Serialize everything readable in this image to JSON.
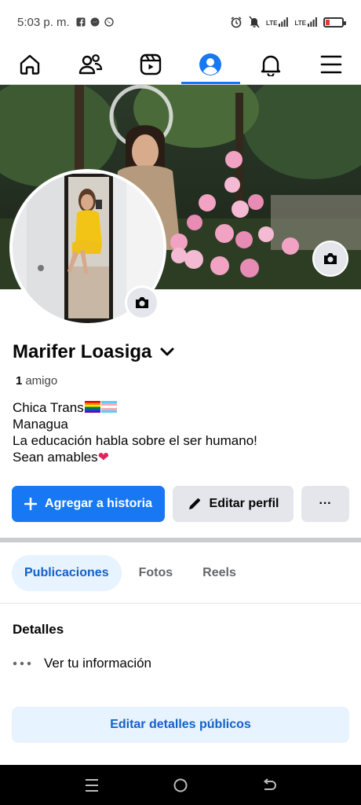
{
  "status_bar": {
    "time": "5:03 p. m.",
    "network": "LTE"
  },
  "nav": {
    "items": [
      {
        "name": "home-icon"
      },
      {
        "name": "friends-icon"
      },
      {
        "name": "reels-icon"
      },
      {
        "name": "profile-icon",
        "active": true
      },
      {
        "name": "bell-icon"
      },
      {
        "name": "menu-icon"
      }
    ]
  },
  "profile": {
    "name": "Marifer Loasiga",
    "friends_count": "1",
    "friends_label": "amigo",
    "bio": {
      "line1": "Chica Trans",
      "line2": "Managua",
      "line3": "La educación habla sobre el ser humano!",
      "line4": "Sean amables"
    }
  },
  "actions": {
    "add_story": "Agregar a historia",
    "edit_profile": "Editar perfil",
    "more": "···"
  },
  "tabs": [
    {
      "label": "Publicaciones",
      "active": true
    },
    {
      "label": "Fotos"
    },
    {
      "label": "Reels"
    }
  ],
  "details": {
    "title": "Detalles",
    "see_info": "Ver tu información",
    "edit_public": "Editar detalles públicos"
  },
  "colors": {
    "accent": "#1877f2",
    "accent_text": "#1461c7",
    "accent_light": "#e7f3ff",
    "button_gray": "#e4e6eb"
  }
}
